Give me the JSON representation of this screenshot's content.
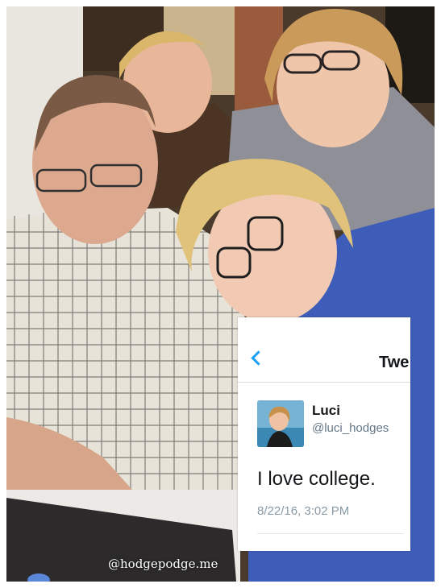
{
  "photo": {
    "description_icon": "family-photo",
    "tweet": {
      "nav_title": "Twe",
      "display_name": "Luci",
      "handle": "@luci_hodges",
      "text": "I love college.",
      "timestamp": "8/22/16, 3:02 PM",
      "accent_color": "#1da1f2"
    },
    "watermark": "@hodgepodge.me"
  }
}
